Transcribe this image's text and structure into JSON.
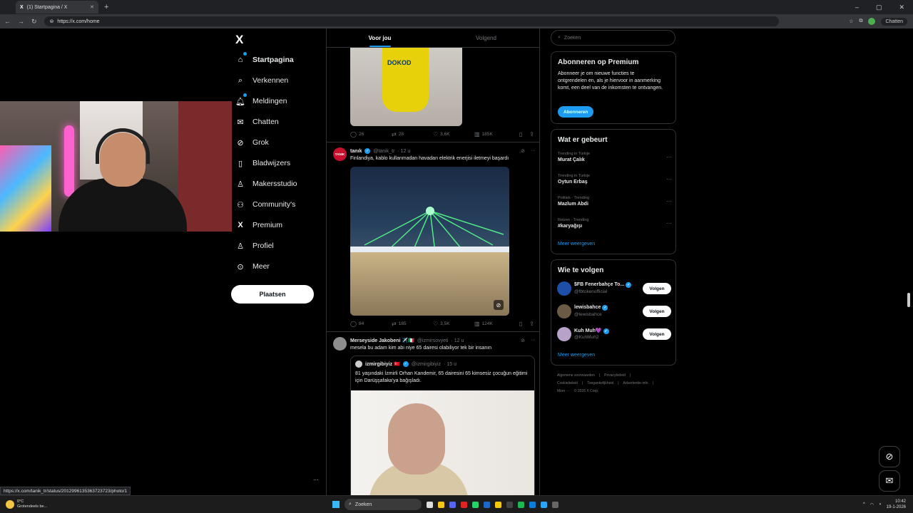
{
  "browser": {
    "tab_title": "(1) Startpagina / X",
    "new_tab": "+",
    "url": "https://x.com/home",
    "chat_label": "Chatten",
    "status_url": "https://x.com/tanik_tr/status/2012996135363723723/photo/1"
  },
  "sidebar": {
    "logo": "X",
    "items": [
      {
        "label": "Startpagina",
        "icon": "home-icon"
      },
      {
        "label": "Verkennen",
        "icon": "search-icon"
      },
      {
        "label": "Meldingen",
        "icon": "bell-icon"
      },
      {
        "label": "Chatten",
        "icon": "mail-icon"
      },
      {
        "label": "Grok",
        "icon": "grok-icon"
      },
      {
        "label": "Bladwijzers",
        "icon": "bookmark-icon"
      },
      {
        "label": "Makersstudio",
        "icon": "creator-icon"
      },
      {
        "label": "Community's",
        "icon": "community-icon"
      },
      {
        "label": "Premium",
        "icon": "x-premium-icon"
      },
      {
        "label": "Profiel",
        "icon": "profile-icon"
      },
      {
        "label": "Meer",
        "icon": "more-icon"
      }
    ],
    "post_button": "Plaatsen",
    "more_dots": "..."
  },
  "feed": {
    "tabs": [
      "Voor jou",
      "Volgend"
    ],
    "post1": {
      "image_text": "DOKOD",
      "stats": {
        "replies": "26",
        "reposts": "28",
        "likes": "3,6K",
        "views": "185K"
      }
    },
    "post2": {
      "avatar_text": "TANIK",
      "name": "tanık",
      "handle": "@tanik_tr",
      "time": "· 12 u",
      "text": "Finlandiya, kablo kullanmadan havadan elektrik enerjisi iletmeyi başardı",
      "stats": {
        "replies": "84",
        "reposts": "185",
        "likes": "3,5K",
        "views": "124K"
      }
    },
    "post3": {
      "name": "Merseyside Jakobeni ✈️🇮🇹",
      "handle": "@izmirsovyeti",
      "time": "· 12 u",
      "text": "mesela bu adam kim abi niye 65 dairesi olabiliyor tek bir insanın",
      "quote": {
        "name": "izmirgibiyiz 🇹🇷",
        "handle": "@izmirgibiyiz",
        "time": "· 15 u",
        "text": "81 yaşındaki İzmirli Orhan Kandemir, 65 dairesini 65 kimsesiz çocuğun eğitimi için Darüşşafaka'ya bağışladı."
      }
    }
  },
  "right": {
    "search_placeholder": "Zoeken",
    "premium": {
      "title": "Abonneren op Premium",
      "text": "Abonneer je om nieuwe functies te ontgrendelen en, als je hiervoor in aanmerking komt, een deel van de inkomsten te ontvangen.",
      "button": "Abonneren"
    },
    "trends": {
      "title": "Wat er gebeurt",
      "items": [
        {
          "category": "Trending in Turkije",
          "title": "Murat Çalık"
        },
        {
          "category": "Trending in Turkije",
          "title": "Oytun Erbaş"
        },
        {
          "category": "Politiek · Trending",
          "title": "Mazlum Abdi"
        },
        {
          "category": "Reizen · Trending",
          "title": "#karyağışı"
        }
      ],
      "more": "Meer weergeven"
    },
    "who_to_follow": {
      "title": "Wie te volgen",
      "items": [
        {
          "name": "$FB Fenerbahçe To...",
          "handle": "@fbtokenofficial",
          "button": "Volgen",
          "color": "#1d4ea8"
        },
        {
          "name": "lewisbahce",
          "handle": "@lewisbahce",
          "button": "Volgen",
          "color": "#6b5a44"
        },
        {
          "name": "Kuh Muh💜",
          "handle": "@KuhMuh2",
          "button": "Volgen",
          "color": "#b7a2c9"
        }
      ],
      "more": "Meer weergeven"
    },
    "footer": [
      "Algemene voorwaarden",
      "|",
      "Privacybeleid",
      "|",
      "Cookiebeleid",
      "|",
      "Toegankelijkheid",
      "|",
      "Advertentie-info",
      "|",
      "Meer ···",
      "© 2026 X Corp."
    ]
  },
  "taskbar": {
    "temp": "0°C",
    "weather": "Grotendeels be...",
    "search": "Zoeken",
    "time": "10:42",
    "date": "19-1-2026"
  }
}
